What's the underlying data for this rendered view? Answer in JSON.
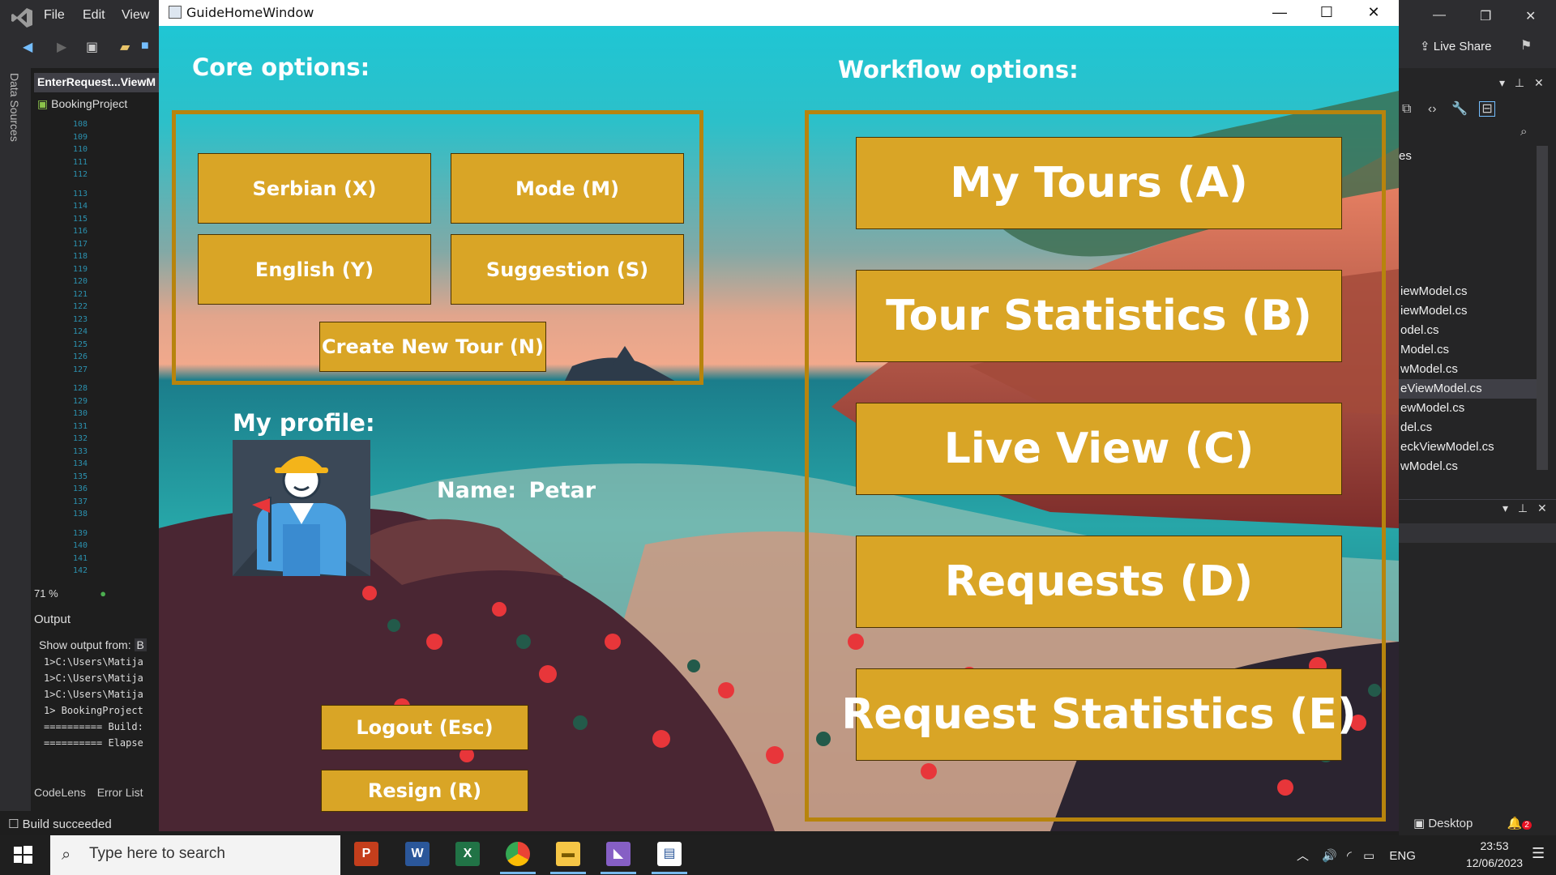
{
  "vs": {
    "menu": [
      "File",
      "Edit",
      "View"
    ],
    "side_panel_label": "Data Sources",
    "doc_tab": "EnterRequest...ViewM",
    "project": "BookingProject",
    "line_numbers": [
      "108",
      "109",
      "110",
      "111",
      "112",
      "113",
      "114",
      "115",
      "116",
      "117",
      "118",
      "119",
      "120",
      "121",
      "122",
      "123",
      "124",
      "125",
      "126",
      "127",
      "128",
      "129",
      "130",
      "131",
      "132",
      "133",
      "134",
      "135",
      "136",
      "137",
      "138",
      "139",
      "140",
      "141",
      "142"
    ],
    "zoom": "71 %",
    "output_title": "Output",
    "output_from_label": "Show output from:",
    "output_from_value": "B",
    "output_lines": [
      "1>C:\\Users\\Matija",
      "1>C:\\Users\\Matija",
      "1>C:\\Users\\Matija",
      "1>  BookingProject",
      "========== Build:",
      "========== Elapse"
    ],
    "bottom_tabs": [
      "CodeLens",
      "Error List"
    ],
    "status": "Build succeeded",
    "live_share": "Live Share",
    "solution_files": [
      "iewModel.cs",
      "iewModel.cs",
      "odel.cs",
      "Model.cs",
      "wModel.cs",
      "eViewModel.cs",
      "ewModel.cs",
      "del.cs",
      "eckViewModel.cs",
      "wModel.cs"
    ],
    "solution_partial": "es",
    "selected_file_index": 5,
    "right_status": "Desktop",
    "notification_count": "2"
  },
  "window": {
    "title": "GuideHomeWindow"
  },
  "core": {
    "header": "Core options:",
    "buttons": {
      "serbian": "Serbian (X)",
      "mode": "Mode (M)",
      "english": "English  (Y)",
      "suggestion": "Suggestion (S)",
      "create_tour": "Create New Tour  (N)"
    }
  },
  "workflow": {
    "header": "Workflow options:",
    "buttons": {
      "my_tours": "My Tours (A)",
      "tour_statistics": "Tour Statistics (B)",
      "live_view": "Live View (C)",
      "requests": "Requests (D)",
      "request_statistics": "Request Statistics (E)"
    }
  },
  "profile": {
    "header": "My profile:",
    "name_label": "Name:",
    "name_value": "Petar"
  },
  "account": {
    "logout": "Logout (Esc)",
    "resign": "Resign (R)"
  },
  "taskbar": {
    "search_placeholder": "Type here to search",
    "language": "ENG",
    "time": "23:53",
    "date": "12/06/2023"
  },
  "colors": {
    "button_fill": "#d9a526",
    "panel_border": "#b7840d",
    "sky_top": "#1fc6d4"
  }
}
